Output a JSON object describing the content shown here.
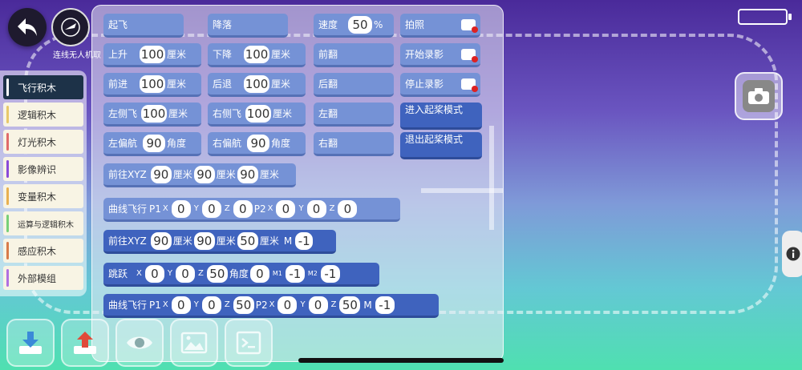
{
  "header": {
    "drone_label": "连线无人机取"
  },
  "sidebar": {
    "items": [
      {
        "label": "飞行积木",
        "color": "#ffffff",
        "active": true
      },
      {
        "label": "逻辑积木",
        "color": "#e8c86a"
      },
      {
        "label": "灯光积木",
        "color": "#e06a6a"
      },
      {
        "label": "影像辨识",
        "color": "#8a4ad8"
      },
      {
        "label": "变量积木",
        "color": "#e8b050"
      },
      {
        "label": "运算与逻辑积木",
        "color": "#78d078"
      },
      {
        "label": "感应积木",
        "color": "#d87a4a"
      },
      {
        "label": "外部模组",
        "color": "#b070e0"
      }
    ]
  },
  "blocks": {
    "takeoff": "起飞",
    "land": "降落",
    "speed": {
      "label": "速度",
      "value": "50",
      "unit": "%"
    },
    "photo": "拍照",
    "up": {
      "label": "上升",
      "value": "100",
      "unit": "厘米"
    },
    "down": {
      "label": "下降",
      "value": "100",
      "unit": "厘米"
    },
    "flip_front": "前翻",
    "start_rec": "开始录影",
    "forward": {
      "label": "前进",
      "value": "100",
      "unit": "厘米"
    },
    "backward": {
      "label": "后退",
      "value": "100",
      "unit": "厘米"
    },
    "flip_back": "后翻",
    "stop_rec": "停止录影",
    "left": {
      "label": "左侧飞",
      "value": "100",
      "unit": "厘米"
    },
    "right": {
      "label": "右侧飞",
      "value": "100",
      "unit": "厘米"
    },
    "flip_left": "左翻",
    "enter_paddle": "进入起桨模式",
    "yaw_left": {
      "label": "左偏航",
      "value": "90",
      "unit": "角度"
    },
    "yaw_right": {
      "label": "右偏航",
      "value": "90",
      "unit": "角度"
    },
    "flip_right": "右翻",
    "exit_paddle": "退出起桨模式",
    "goto_xyz": {
      "label": "前往XYZ",
      "x": "90",
      "y": "90",
      "z": "90",
      "unit": "厘米"
    },
    "curve": {
      "label": "曲线飞行",
      "p1": "P1",
      "p2": "P2",
      "x": "X",
      "y": "Y",
      "z": "Z",
      "x1": "0",
      "y1": "0",
      "z1": "0",
      "x2": "0",
      "y2": "0",
      "z2": "0"
    },
    "goto_xyz_m": {
      "label": "前往XYZ",
      "x": "90",
      "y": "90",
      "z": "50",
      "unit": "厘米",
      "m": "M",
      "mv": "-1"
    },
    "jump": {
      "label": "跳跃",
      "x": "X",
      "y": "Y",
      "z": "Z",
      "xv": "0",
      "yv": "0",
      "zv": "50",
      "angle": "角度",
      "av": "0",
      "m1": "M1",
      "m1v": "-1",
      "m2": "M2",
      "m2v": "-1"
    },
    "curve_m": {
      "label": "曲线飞行",
      "p1": "P1",
      "p2": "P2",
      "x": "X",
      "y": "Y",
      "z": "Z",
      "x1": "0",
      "y1": "0",
      "z1": "50",
      "x2": "0",
      "y2": "0",
      "z2": "50",
      "m": "M",
      "mv": "-1"
    }
  },
  "colors": {
    "block": "#7592d6",
    "block_dark": "#3f63be"
  }
}
